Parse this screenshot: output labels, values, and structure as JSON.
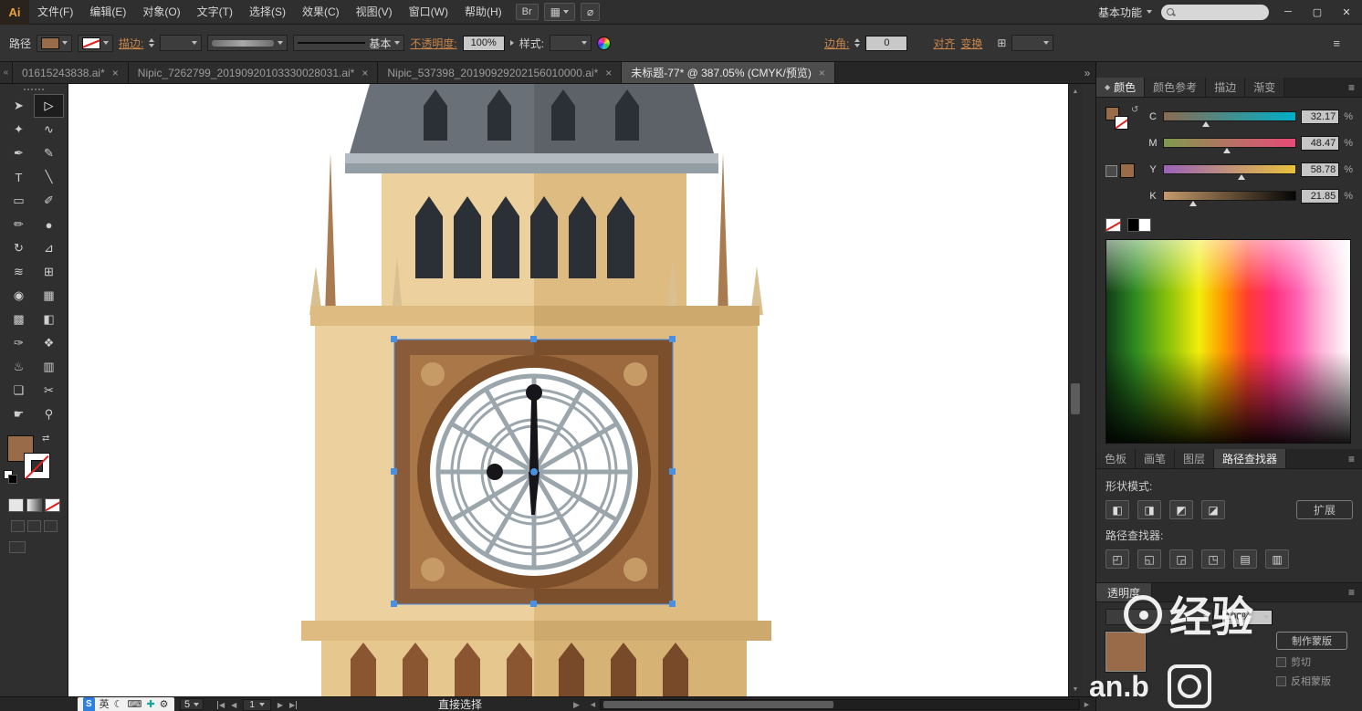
{
  "window": {
    "app_label": "Ai",
    "workspace": "基本功能",
    "minimize_glyph": "─",
    "restore_glyph": "▢",
    "close_glyph": "✕"
  },
  "menubar": {
    "items": [
      "文件(F)",
      "编辑(E)",
      "对象(O)",
      "文字(T)",
      "选择(S)",
      "效果(C)",
      "视图(V)",
      "窗口(W)",
      "帮助(H)"
    ],
    "bridge_label": "Br"
  },
  "control_bar": {
    "context_label": "路径",
    "stroke_link": "描边:",
    "brush_name": "基本",
    "opacity_link": "不透明度:",
    "opacity_value": "100%",
    "style_label": "样式:",
    "corner_link": "边角:",
    "corner_value": "0",
    "align_link": "对齐",
    "transform_link": "变换"
  },
  "document_tabs": [
    {
      "label": "01615243838.ai*",
      "active": false
    },
    {
      "label": "Nipic_7262799_20190920103330028031.ai*",
      "active": false
    },
    {
      "label": "Nipic_537398_20190929202156010000.ai*",
      "active": false
    },
    {
      "label": "未标题-77* @ 387.05% (CMYK/预览)",
      "active": true
    }
  ],
  "icons": {
    "close": "×",
    "tab_overflow": "»",
    "tab_collapse": "«",
    "panel_menu": "≡",
    "arrange_documents": "▦",
    "cs_live": "⌀",
    "transform_grid": "⊞",
    "swap": "⇄",
    "swap_small": "↺",
    "diamond": "◆",
    "scroll_up": "▲",
    "scroll_down": "▼",
    "scroll_left": "◀",
    "scroll_right": "▶",
    "nav_first": "◀",
    "nav_prev": "◀",
    "nav_next": "▶",
    "nav_last": "▶",
    "status_arrow": "▶"
  },
  "toolbar": {
    "tools": [
      {
        "name": "selection",
        "glyph": "➤"
      },
      {
        "name": "direct-selection",
        "glyph": "▷",
        "active": true
      },
      {
        "name": "magic-wand",
        "glyph": "✦"
      },
      {
        "name": "lasso",
        "glyph": "∿"
      },
      {
        "name": "pen",
        "glyph": "✒"
      },
      {
        "name": "curvature",
        "glyph": "✎"
      },
      {
        "name": "type",
        "glyph": "T"
      },
      {
        "name": "line-segment",
        "glyph": "╲"
      },
      {
        "name": "rectangle",
        "glyph": "▭"
      },
      {
        "name": "paintbrush",
        "glyph": "✐"
      },
      {
        "name": "pencil",
        "glyph": "✏"
      },
      {
        "name": "blob-brush",
        "glyph": "●"
      },
      {
        "name": "rotate",
        "glyph": "↻"
      },
      {
        "name": "scale",
        "glyph": "⊿"
      },
      {
        "name": "width",
        "glyph": "≋"
      },
      {
        "name": "free-transform",
        "glyph": "⊞"
      },
      {
        "name": "shape-builder",
        "glyph": "◉"
      },
      {
        "name": "perspective-grid",
        "glyph": "▦"
      },
      {
        "name": "mesh",
        "glyph": "▩"
      },
      {
        "name": "gradient",
        "glyph": "◧"
      },
      {
        "name": "eyedropper",
        "glyph": "✑"
      },
      {
        "name": "blend",
        "glyph": "❖"
      },
      {
        "name": "symbol-sprayer",
        "glyph": "♨"
      },
      {
        "name": "column-graph",
        "glyph": "▥"
      },
      {
        "name": "artboard",
        "glyph": "❏"
      },
      {
        "name": "slice",
        "glyph": "✂"
      },
      {
        "name": "hand",
        "glyph": "☛"
      },
      {
        "name": "zoom",
        "glyph": "⚲"
      }
    ]
  },
  "color_panel": {
    "tabs": [
      "颜色",
      "颜色参考",
      "描边",
      "渐变"
    ],
    "channels": [
      {
        "label": "C",
        "value": "32.17",
        "unit": "%"
      },
      {
        "label": "M",
        "value": "48.47",
        "unit": "%"
      },
      {
        "label": "Y",
        "value": "58.78",
        "unit": "%"
      },
      {
        "label": "K",
        "value": "21.85",
        "unit": "%"
      }
    ]
  },
  "panel_tabs": [
    "色板",
    "画笔",
    "图层",
    "路径查找器"
  ],
  "pathfinder": {
    "shape_modes_label": "形状模式:",
    "buttons": [
      "◧",
      "◨",
      "◩",
      "◪"
    ],
    "expand_label": "扩展",
    "pathfinder_label": "路径查找器:",
    "pathfinder_buttons": [
      "◰",
      "◱",
      "◲",
      "◳",
      "▤",
      "▥"
    ]
  },
  "transparency": {
    "title": "透明度",
    "opacity_value": "100%",
    "make_mask_label": "制作蒙版",
    "clip_label": "剪切",
    "invert_label": "反相蒙版"
  },
  "status_bar": {
    "zoom_visible": "5",
    "artboard_number": "1",
    "active_tool": "直接选择"
  },
  "language_bar": {
    "ime": "S",
    "mode": "英",
    "moon": "☾",
    "keyboard": "⌨",
    "plus": "✚",
    "gear": "⚙"
  },
  "watermark": {
    "main": "经验",
    "fragment": "an.b"
  },
  "artwork": {
    "colors": {
      "roof_light": "#6a7077",
      "roof_shade": "#5c6268",
      "window_dark": "#2b2f36",
      "cornice_light": "#b3bac0",
      "cornice_mid": "#939da4",
      "body_light": "#ecd09e",
      "body_shade": "#debb80",
      "spire_brown": "#a87c50",
      "finial_tan": "#d9c091",
      "ledge_light": "#ddbb81",
      "ledge_shade": "#cda96e",
      "base_light": "#e6c88f",
      "base_shade": "#d6b274",
      "cren_left": "#8a5631",
      "cren_right": "#794a29",
      "frame_outer": "#8a5b38",
      "frame_outer_shade": "#7b4e2c",
      "frame_inner": "#aa7748",
      "frame_inner_shade": "#9c6a3e",
      "corner_circle": "#c79b66",
      "clock_ring": "#7c4e2a",
      "clock_face": "#ffffff",
      "spoke": "#9aa5ac",
      "hand_black": "#15151a",
      "selection_blue": "#4a90e2"
    }
  }
}
